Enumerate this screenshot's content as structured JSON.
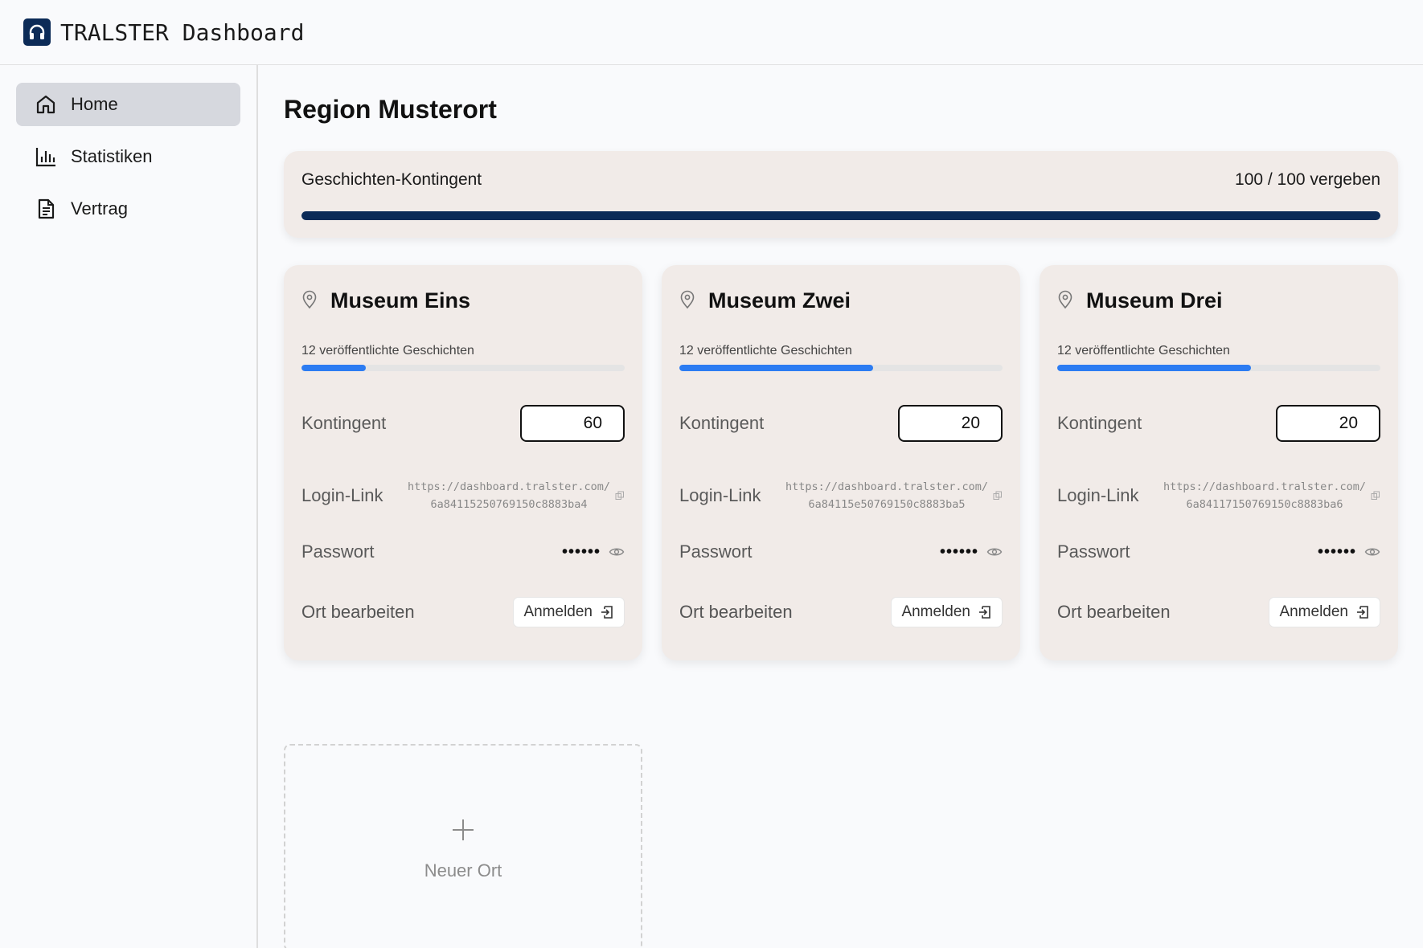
{
  "app": {
    "brand": "TRALSTER Dashboard",
    "colors": {
      "brand_navy": "#0c2b57",
      "accent_blue": "#2c7cf2",
      "card_bg": "#f1ebe8"
    }
  },
  "sidebar": {
    "items": [
      {
        "label": "Home",
        "icon": "home-icon",
        "active": true
      },
      {
        "label": "Statistiken",
        "icon": "bar-chart-icon",
        "active": false
      },
      {
        "label": "Vertrag",
        "icon": "document-icon",
        "active": false
      }
    ]
  },
  "main": {
    "title": "Region Musterort",
    "quota": {
      "label": "Geschichten-Kontingent",
      "status": "100 / 100 vergeben",
      "used": 100,
      "total": 100
    },
    "locations": [
      {
        "name": "Museum Eins",
        "published": "12 veröffentlichte Geschichten",
        "published_fraction": 0.2,
        "kontingent_label": "Kontingent",
        "kontingent": "60",
        "login_label": "Login-Link",
        "login_link": "https://dashboard.tralster.com/6a84115250769150c8883ba4",
        "password_label": "Passwort",
        "password": "••••••",
        "edit_label": "Ort bearbeiten",
        "login_button": "Anmelden"
      },
      {
        "name": "Museum Zwei",
        "published": "12 veröffentlichte Geschichten",
        "published_fraction": 0.6,
        "kontingent_label": "Kontingent",
        "kontingent": "20",
        "login_label": "Login-Link",
        "login_link": "https://dashboard.tralster.com/6a84115e50769150c8883ba5",
        "password_label": "Passwort",
        "password": "••••••",
        "edit_label": "Ort bearbeiten",
        "login_button": "Anmelden"
      },
      {
        "name": "Museum Drei",
        "published": "12 veröffentlichte Geschichten",
        "published_fraction": 0.6,
        "kontingent_label": "Kontingent",
        "kontingent": "20",
        "login_label": "Login-Link",
        "login_link": "https://dashboard.tralster.com/6a84117150769150c8883ba6",
        "password_label": "Passwort",
        "password": "••••••",
        "edit_label": "Ort bearbeiten",
        "login_button": "Anmelden"
      }
    ],
    "new_location": {
      "label": "Neuer Ort",
      "icon": "plus-icon"
    }
  }
}
